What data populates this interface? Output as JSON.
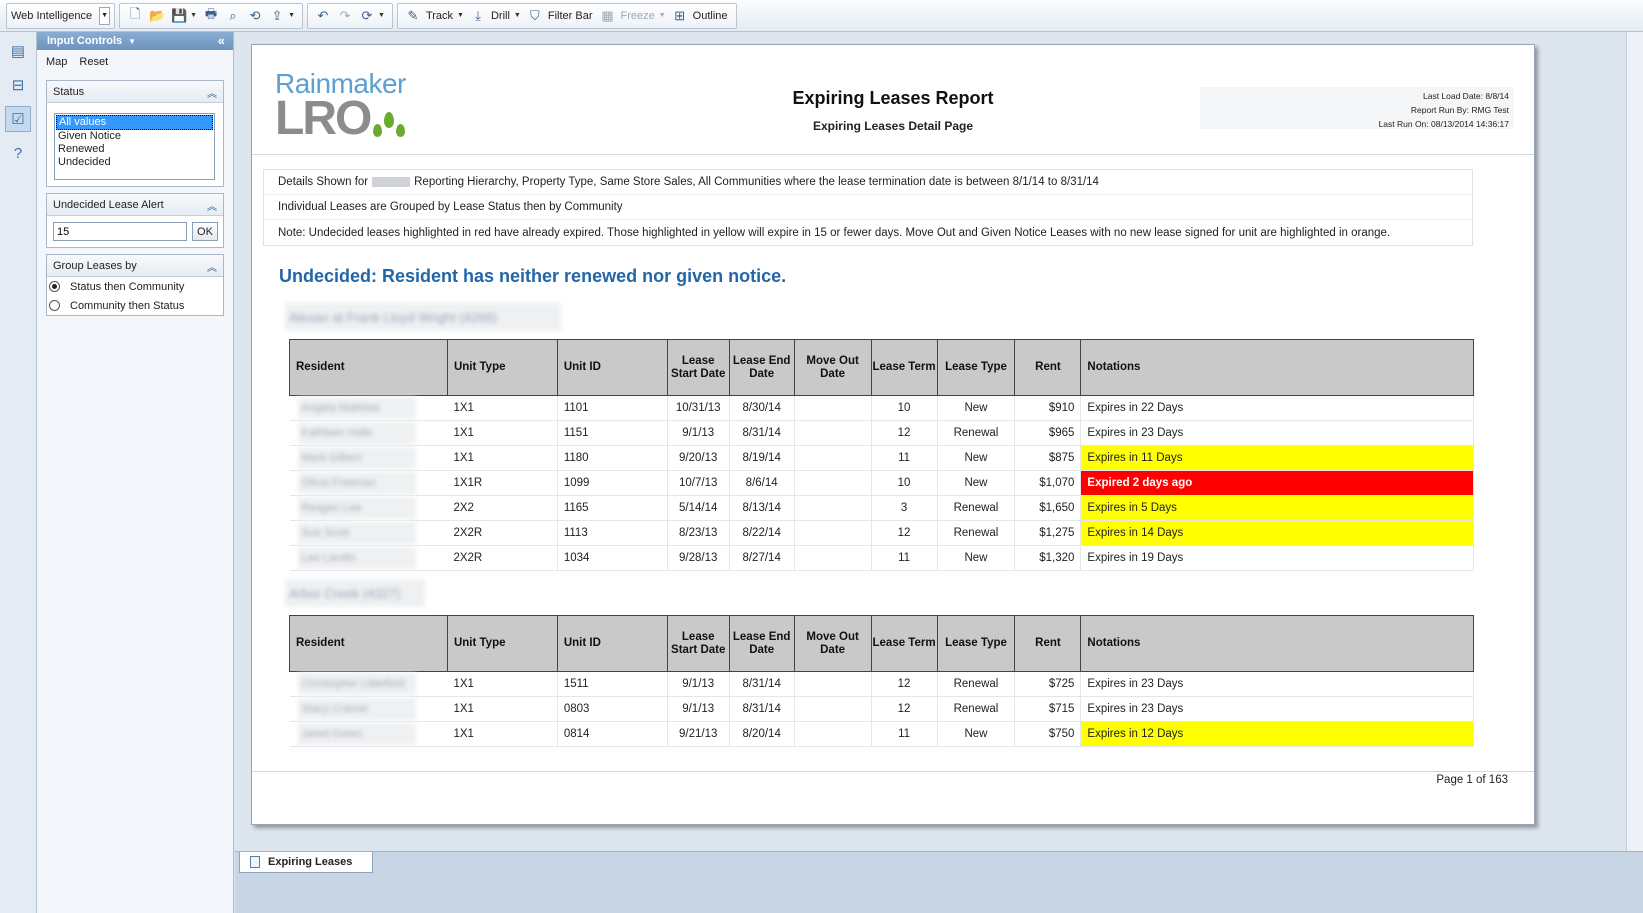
{
  "toolbar": {
    "app_name": "Web Intelligence",
    "track_label": "Track",
    "drill_label": "Drill",
    "filter_bar_label": "Filter Bar",
    "freeze_label": "Freeze",
    "outline_label": "Outline"
  },
  "panel": {
    "title": "Input Controls",
    "links": {
      "map": "Map",
      "reset": "Reset"
    },
    "status": {
      "title": "Status",
      "options": [
        "All values",
        "Given Notice",
        "Renewed",
        "Undecided"
      ],
      "selected": "All values"
    },
    "alert": {
      "title": "Undecided Lease Alert",
      "value": "15",
      "ok_label": "OK"
    },
    "group_by": {
      "title": "Group Leases by",
      "options": [
        "Status then Community",
        "Community then Status"
      ],
      "selected": "Status then Community"
    }
  },
  "report": {
    "logo_top": "Rainmaker",
    "logo_bottom": "LRO",
    "title": "Expiring Leases Report",
    "subtitle": "Expiring Leases Detail Page",
    "meta": {
      "last_load": "Last Load Date: 8/8/14",
      "run_by": "Report Run By:  RMG Test",
      "last_run": "Last Run On: 08/13/2014 14:36:17"
    },
    "notes": {
      "details_prefix": "Details Shown for",
      "details_suffix": "Reporting Hierarchy, Property Type, Same Store Sales,  All Communities where the lease termination date is between 8/1/14 to 8/31/14",
      "grouping": "Individual Leases are Grouped by Lease Status then by Community",
      "highlight": "Note: Undecided leases highlighted in red have already expired. Those highlighted in yellow will expire in 15 or fewer days. Move Out and Given Notice Leases with no new lease signed for unit are highlighted in orange."
    },
    "section_title": "Undecided: Resident has neither renewed nor given notice.",
    "columns": {
      "resident": "Resident",
      "unit_type": "Unit Type",
      "unit_id": "Unit ID",
      "lease_start": "Lease Start Date",
      "lease_end": "Lease End Date",
      "move_out": "Move Out Date",
      "lease_term": "Lease Term",
      "lease_type": "Lease Type",
      "rent": "Rent",
      "notations": "Notations"
    },
    "groups": [
      {
        "community": "Alexan at Frank Lloyd Wright (4268)",
        "rows": [
          {
            "resident": "Angela Mathilas",
            "unit_type": "1X1",
            "unit_id": "1101",
            "start": "10/31/13",
            "end": "8/30/14",
            "move_out": "",
            "term": "10",
            "type": "New",
            "rent": "$910",
            "note": "Expires in 22 Days",
            "highlight": ""
          },
          {
            "resident": "Kathleen Halls",
            "unit_type": "1X1",
            "unit_id": "1151",
            "start": "9/1/13",
            "end": "8/31/14",
            "move_out": "",
            "term": "12",
            "type": "Renewal",
            "rent": "$965",
            "note": "Expires in 23 Days",
            "highlight": ""
          },
          {
            "resident": "Mark Gilbert",
            "unit_type": "1X1",
            "unit_id": "1180",
            "start": "9/20/13",
            "end": "8/19/14",
            "move_out": "",
            "term": "11",
            "type": "New",
            "rent": "$875",
            "note": "Expires in 11 Days",
            "highlight": "yellow"
          },
          {
            "resident": "Olivia Freeman",
            "unit_type": "1X1R",
            "unit_id": "1099",
            "start": "10/7/13",
            "end": "8/6/14",
            "move_out": "",
            "term": "10",
            "type": "New",
            "rent": "$1,070",
            "note": "Expired 2 days ago",
            "highlight": "red"
          },
          {
            "resident": "Reagan Lee",
            "unit_type": "2X2",
            "unit_id": "1165",
            "start": "5/14/14",
            "end": "8/13/14",
            "move_out": "",
            "term": "3",
            "type": "Renewal",
            "rent": "$1,650",
            "note": "Expires in 5 Days",
            "highlight": "yellow"
          },
          {
            "resident": "Sue Scott",
            "unit_type": "2X2R",
            "unit_id": "1113",
            "start": "8/23/13",
            "end": "8/22/14",
            "move_out": "",
            "term": "12",
            "type": "Renewal",
            "rent": "$1,275",
            "note": "Expires in 14 Days",
            "highlight": "yellow"
          },
          {
            "resident": "Lee Landis",
            "unit_type": "2X2R",
            "unit_id": "1034",
            "start": "9/28/13",
            "end": "8/27/14",
            "move_out": "",
            "term": "11",
            "type": "New",
            "rent": "$1,320",
            "note": "Expires in 19 Days",
            "highlight": ""
          }
        ]
      },
      {
        "community": "Arbor Creek (4327)",
        "rows": [
          {
            "resident": "Christopher Littlefield",
            "unit_type": "1X1",
            "unit_id": "1511",
            "start": "9/1/13",
            "end": "8/31/14",
            "move_out": "",
            "term": "12",
            "type": "Renewal",
            "rent": "$725",
            "note": "Expires in 23 Days",
            "highlight": ""
          },
          {
            "resident": "Stacy Cramer",
            "unit_type": "1X1",
            "unit_id": "0803",
            "start": "9/1/13",
            "end": "8/31/14",
            "move_out": "",
            "term": "12",
            "type": "Renewal",
            "rent": "$715",
            "note": "Expires in 23 Days",
            "highlight": ""
          },
          {
            "resident": "Jared Green",
            "unit_type": "1X1",
            "unit_id": "0814",
            "start": "9/21/13",
            "end": "8/20/14",
            "move_out": "",
            "term": "11",
            "type": "New",
            "rent": "$750",
            "note": "Expires in 12 Days",
            "highlight": "yellow"
          }
        ]
      }
    ],
    "page_label": "Page 1 of 163"
  },
  "tabs": [
    {
      "label": "Expiring Leases"
    }
  ],
  "colors": {
    "expired": "#ff0000",
    "warning": "#ffff00",
    "section_title": "#2366a8",
    "header_fill": "#c9c9c9"
  }
}
